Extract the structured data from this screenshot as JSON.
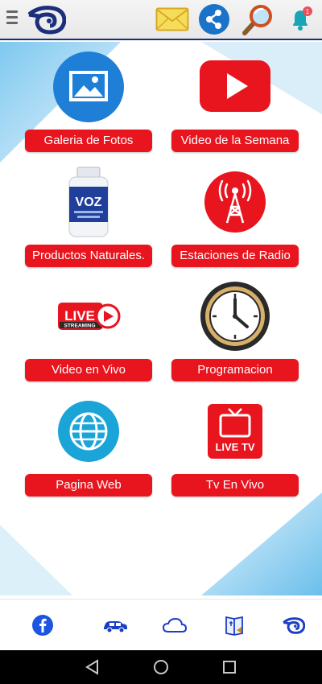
{
  "header": {
    "icons": [
      "menu-icon",
      "logo-icon",
      "mail-icon",
      "share-icon",
      "search-icon",
      "bell-icon"
    ],
    "notification_count": "1"
  },
  "tiles": [
    {
      "label": "Galeria de Fotos",
      "icon": "photo-gallery-icon"
    },
    {
      "label": "Video de la Semana",
      "icon": "youtube-play-icon"
    },
    {
      "label": "Productos Naturales.",
      "icon": "product-bottle-icon",
      "product_text": "VOZ"
    },
    {
      "label": "Estaciones de Radio",
      "icon": "radio-tower-icon"
    },
    {
      "label": "Video en Vivo",
      "icon": "live-streaming-icon",
      "badge_text": "LIVE",
      "badge_sub": "STREAMING"
    },
    {
      "label": "Programacion",
      "icon": "clock-icon"
    },
    {
      "label": "Pagina Web",
      "icon": "globe-icon"
    },
    {
      "label": "Tv En Vivo",
      "icon": "live-tv-icon",
      "badge_text": "LIVE TV"
    }
  ],
  "bottom_nav": {
    "icons": [
      "facebook-icon",
      "car-icon",
      "cloud-icon",
      "bible-icon",
      "logo-icon"
    ]
  },
  "colors": {
    "accent": "#e8141e",
    "brand_blue": "#1c2f7a",
    "share_blue": "#1a73c8",
    "mail_yellow": "#f0d040",
    "bell_teal": "#17a5b8"
  }
}
